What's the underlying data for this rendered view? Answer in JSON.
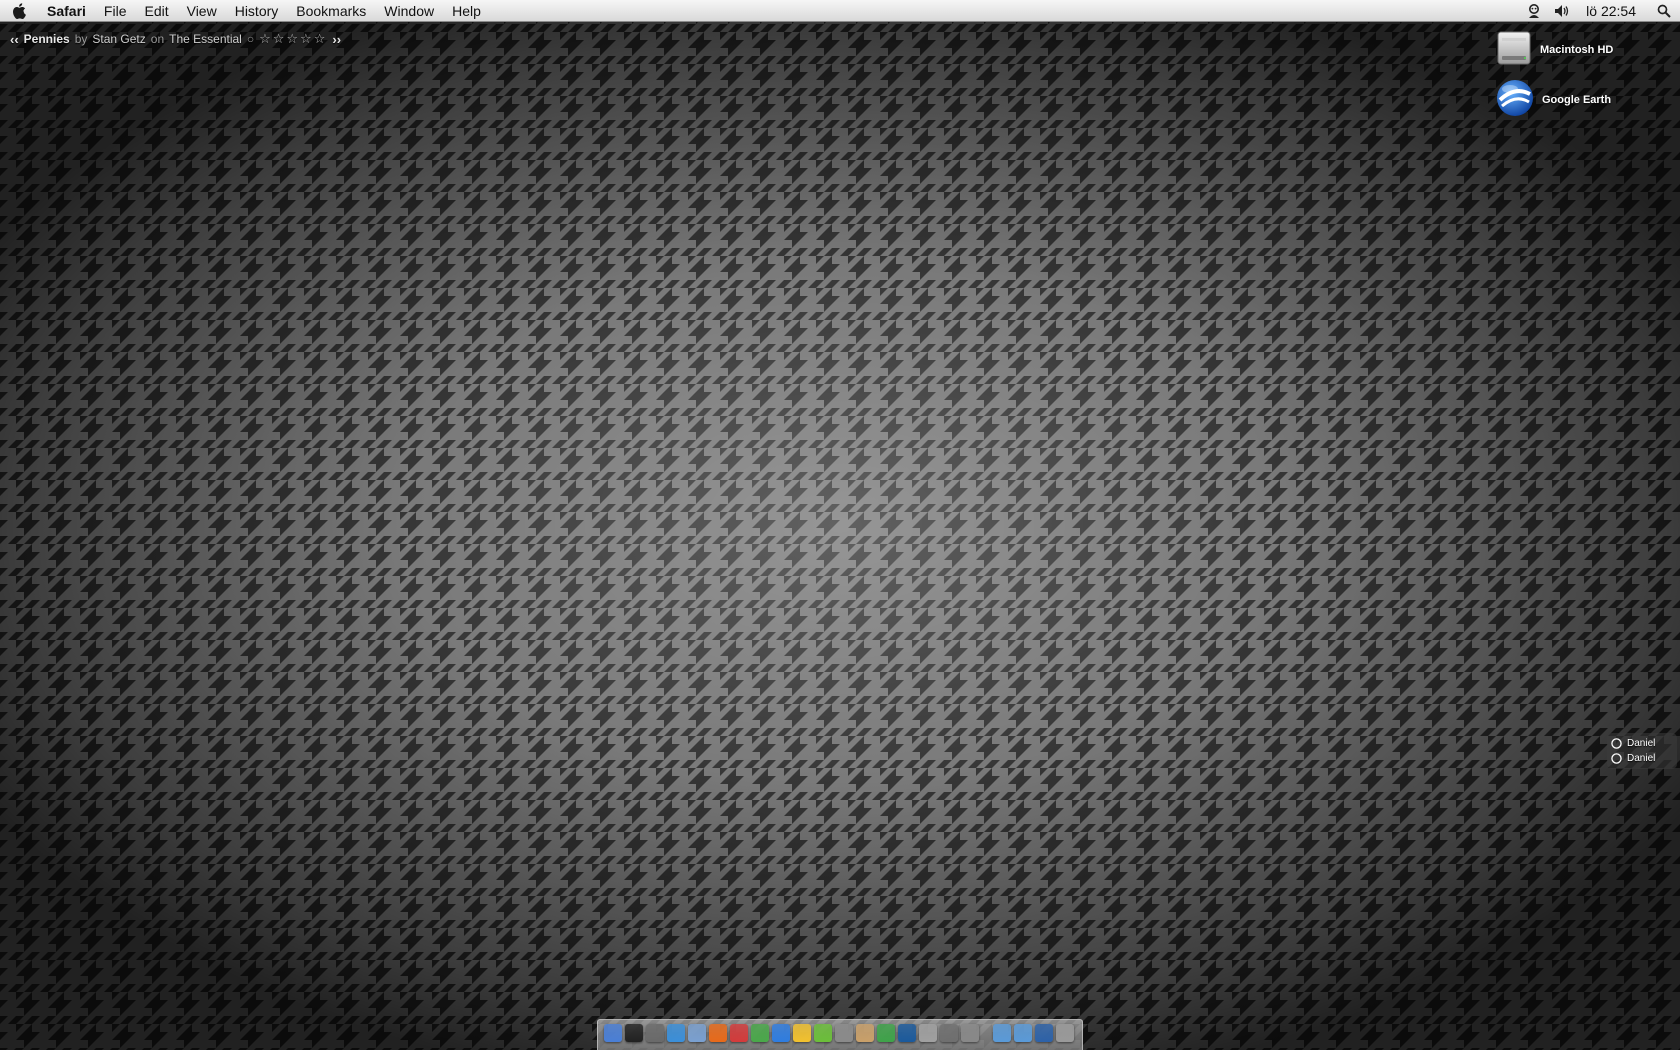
{
  "menubar": {
    "apple_icon": "apple-icon",
    "app_name": "Safari",
    "items": [
      "File",
      "Edit",
      "View",
      "History",
      "Bookmarks",
      "Window",
      "Help"
    ],
    "status_icons": [
      "user-icon",
      "volume-icon"
    ],
    "clock": "lö 22:54",
    "spotlight_icon": "search-icon"
  },
  "now_playing": {
    "prev": "‹‹",
    "title": "Pennies",
    "by_word": "by",
    "artist": "Stan Getz",
    "on_word": "on",
    "album": "The Essential",
    "rating_mark": "○",
    "stars": "☆☆☆☆☆",
    "next": "››"
  },
  "desktop_icons": [
    {
      "label": "Macintosh HD",
      "icon": "hard-drive-icon"
    },
    {
      "label": "Google Earth",
      "icon": "google-earth-icon"
    }
  ],
  "notifications": [
    {
      "label": "Daniel",
      "icon": "chat-icon"
    },
    {
      "label": "Daniel",
      "icon": "chat-icon"
    }
  ],
  "dock": {
    "apps": [
      {
        "name": "finder-icon",
        "color": "#4a7fd6"
      },
      {
        "name": "terminal-icon",
        "color": "#222222"
      },
      {
        "name": "system-preferences-icon",
        "color": "#6a6a6a"
      },
      {
        "name": "safari-icon",
        "color": "#3b8fd9"
      },
      {
        "name": "mail-icon",
        "color": "#7aa0d0"
      },
      {
        "name": "firefox-icon",
        "color": "#e86a1a"
      },
      {
        "name": "ical-icon",
        "color": "#d33b3b"
      },
      {
        "name": "messages-icon",
        "color": "#4aa84a"
      },
      {
        "name": "itunes-icon",
        "color": "#2f7de0"
      },
      {
        "name": "adium-icon",
        "color": "#f2c12e"
      },
      {
        "name": "spotify-icon",
        "color": "#6cbf3a"
      },
      {
        "name": "script-editor-icon",
        "color": "#8a8a8a"
      },
      {
        "name": "preview-icon",
        "color": "#c9a06a"
      },
      {
        "name": "dreamweaver-icon",
        "color": "#3fa34a"
      },
      {
        "name": "photoshop-icon",
        "color": "#1b5a9c"
      },
      {
        "name": "image-capture-icon",
        "color": "#a0a0a0"
      },
      {
        "name": "dashboard-icon",
        "color": "#6f6f6f"
      },
      {
        "name": "utility-icon",
        "color": "#888888"
      }
    ],
    "stacks": [
      {
        "name": "folder-icon",
        "color": "#5a9ad8"
      },
      {
        "name": "downloads-folder-icon",
        "color": "#5a9ad8"
      },
      {
        "name": "applications-folder-icon",
        "color": "#2d62a8"
      },
      {
        "name": "trash-icon",
        "color": "#9a9a9a"
      }
    ]
  }
}
